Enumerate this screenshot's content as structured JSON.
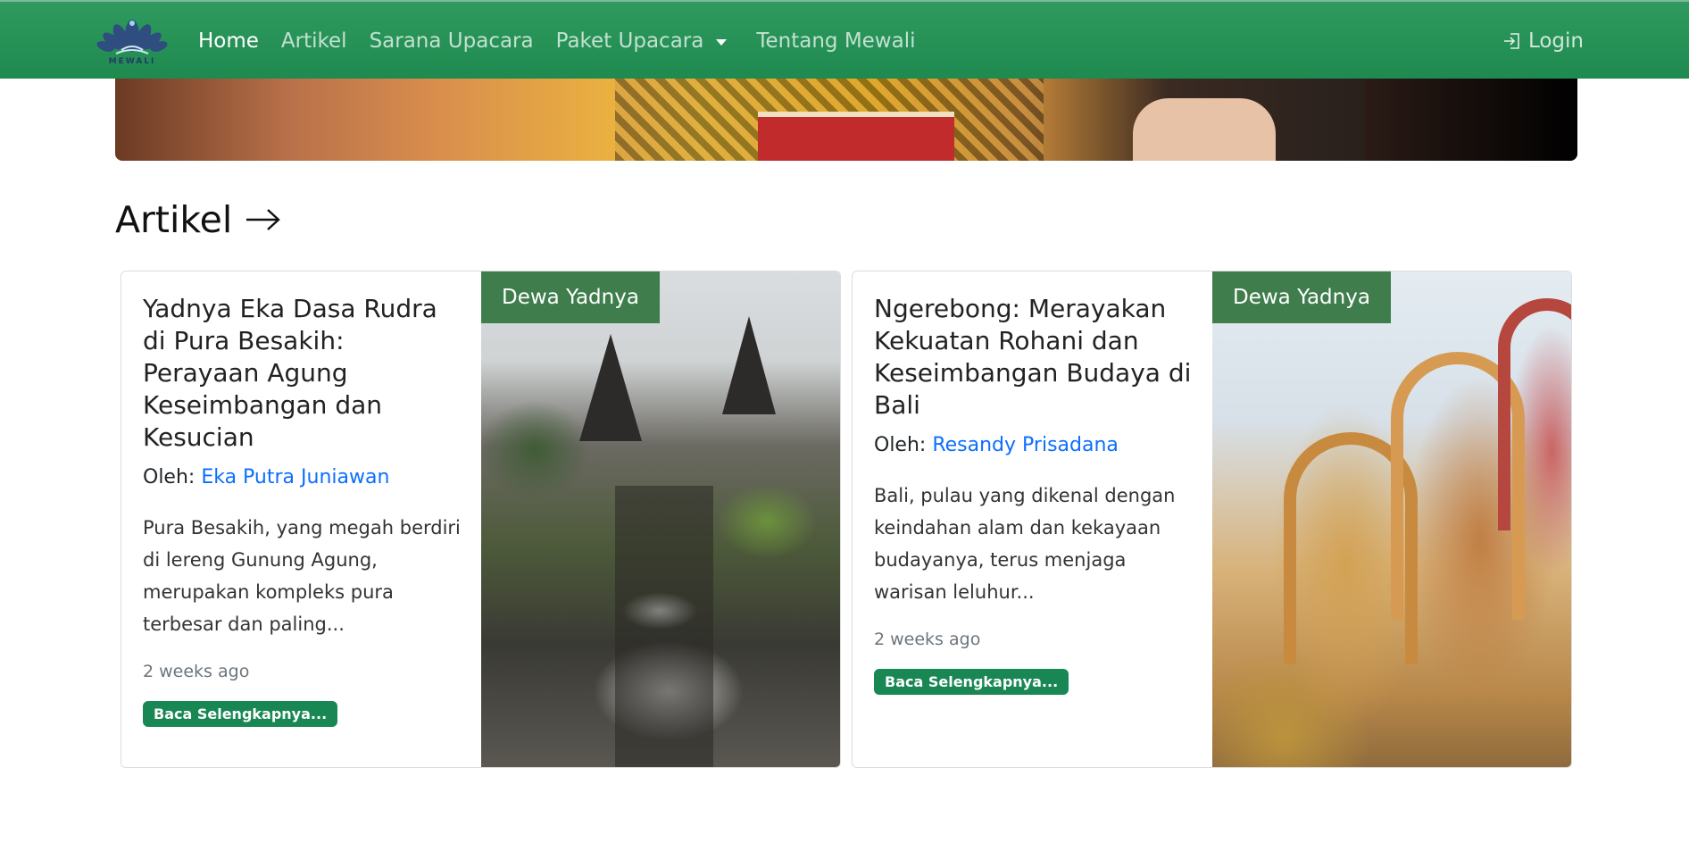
{
  "navbar": {
    "logo_text": "MEWALI",
    "links": [
      {
        "label": "Home",
        "active": true
      },
      {
        "label": "Artikel",
        "active": false
      },
      {
        "label": "Sarana Upacara",
        "active": false
      }
    ],
    "dropdown_label": "Paket Upacara",
    "about_label": "Tentang Mewali",
    "login_label": "Login"
  },
  "section": {
    "title": "Artikel"
  },
  "articles": [
    {
      "category": "Dewa Yadnya",
      "title": "Yadnya Eka Dasa Rudra di Pura Besakih: Perayaan Agung Keseimbangan dan Kesucian",
      "author_prefix": "Oleh:",
      "author": "Eka Putra Juniawan",
      "excerpt": "Pura Besakih, yang megah berdiri di lereng Gunung Agung, merupakan kompleks pura terbesar dan paling...",
      "time": "2 weeks ago",
      "button": "Baca Selengkapnya..."
    },
    {
      "category": "Dewa Yadnya",
      "title": "Ngerebong: Merayakan Kekuatan Rohani dan Keseimbangan Budaya di Bali",
      "author_prefix": "Oleh:",
      "author": "Resandy Prisadana",
      "excerpt": "Bali, pulau yang dikenal dengan keindahan alam dan kekayaan budayanya, terus menjaga warisan leluhur...",
      "time": "2 weeks ago",
      "button": "Baca Selengkapnya..."
    }
  ],
  "colors": {
    "navbar": "#1f8a4f",
    "tag": "#3f7e4c",
    "button": "#198754",
    "link": "#0d6efd"
  }
}
